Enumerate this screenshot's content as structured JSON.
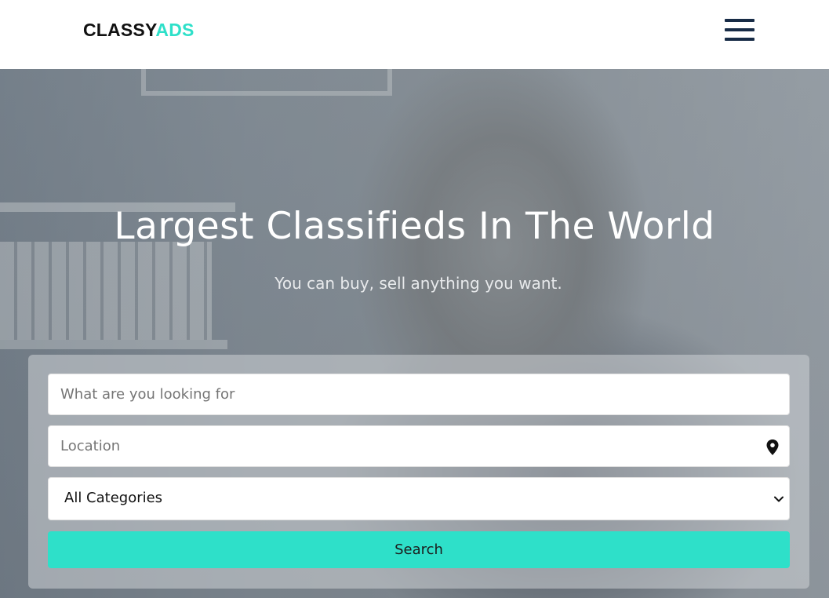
{
  "header": {
    "logo_part1": "CLASSY",
    "logo_part2": "ADS",
    "menu_icon": "hamburger-menu-icon"
  },
  "hero": {
    "title": "Largest Classifieds In The World",
    "subtitle": "You can buy, sell anything you want."
  },
  "search": {
    "what_placeholder": "What are you looking for",
    "location_placeholder": "Location",
    "location_icon": "map-pin-icon",
    "category_selected": "All Categories",
    "category_icon": "chevron-down-icon",
    "button_label": "Search"
  },
  "colors": {
    "accent": "#2ee0c9",
    "menu_icon": "#172b46",
    "title_text": "#ffffff"
  }
}
